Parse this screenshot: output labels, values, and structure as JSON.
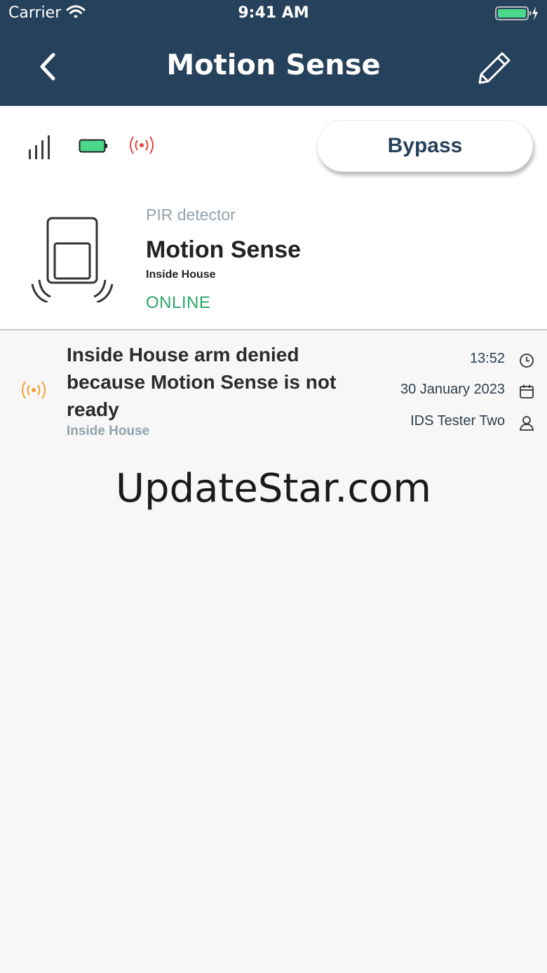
{
  "status_bar": {
    "carrier": "Carrier",
    "time": "9:41 AM"
  },
  "header": {
    "title": "Motion Sense"
  },
  "device_status_icons": [
    "signal-icon",
    "battery-icon",
    "alarm-signal-icon"
  ],
  "bypass_label": "Bypass",
  "device": {
    "type": "PIR detector",
    "name": "Motion Sense",
    "zone": "Inside House",
    "status": "ONLINE"
  },
  "events": [
    {
      "message": "Inside House arm denied because Motion Sense is not ready",
      "zone": "Inside House",
      "time": "13:52",
      "date": "30 January 2023",
      "user": "IDS Tester Two"
    }
  ],
  "watermark": "UpdateStar.com",
  "colors": {
    "header_bg": "#26415b",
    "online": "#2aa76a",
    "alarm_red": "#e0443c",
    "alarm_orange": "#f0a030",
    "battery_green": "#4cd88a"
  }
}
